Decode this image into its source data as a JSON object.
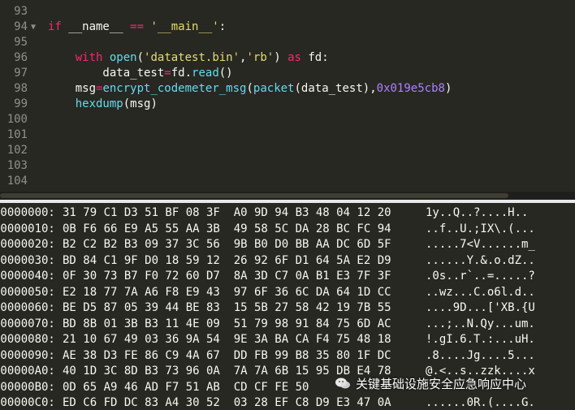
{
  "editor": {
    "lines": [
      {
        "num": "93",
        "fold": "",
        "tokens": []
      },
      {
        "num": "94",
        "fold": "▼",
        "tokens": [
          {
            "t": "if",
            "c": "kw"
          },
          {
            "t": " __name__ ",
            "c": ""
          },
          {
            "t": "==",
            "c": "kw"
          },
          {
            "t": " ",
            "c": ""
          },
          {
            "t": "'__main__'",
            "c": "str"
          },
          {
            "t": ":",
            "c": ""
          }
        ]
      },
      {
        "num": "95",
        "fold": "",
        "tokens": []
      },
      {
        "num": "96",
        "fold": "",
        "tokens": [
          {
            "t": "    ",
            "c": ""
          },
          {
            "t": "with",
            "c": "kw"
          },
          {
            "t": " ",
            "c": ""
          },
          {
            "t": "open",
            "c": "fn"
          },
          {
            "t": "(",
            "c": ""
          },
          {
            "t": "'datatest.bin'",
            "c": "str"
          },
          {
            "t": ",",
            "c": ""
          },
          {
            "t": "'rb'",
            "c": "str"
          },
          {
            "t": ") ",
            "c": ""
          },
          {
            "t": "as",
            "c": "kw"
          },
          {
            "t": " fd:",
            "c": ""
          }
        ]
      },
      {
        "num": "97",
        "fold": "",
        "tokens": [
          {
            "t": "        data_test",
            "c": ""
          },
          {
            "t": "=",
            "c": "kw"
          },
          {
            "t": "fd.",
            "c": ""
          },
          {
            "t": "read",
            "c": "fn"
          },
          {
            "t": "()",
            "c": ""
          }
        ]
      },
      {
        "num": "98",
        "fold": "",
        "tokens": [
          {
            "t": "    msg",
            "c": ""
          },
          {
            "t": "=",
            "c": "kw"
          },
          {
            "t": "encrypt_codemeter_msg",
            "c": "fn"
          },
          {
            "t": "(",
            "c": ""
          },
          {
            "t": "packet",
            "c": "fn"
          },
          {
            "t": "(data_test),",
            "c": ""
          },
          {
            "t": "0x019e5cb8",
            "c": "num"
          },
          {
            "t": ")",
            "c": ""
          }
        ]
      },
      {
        "num": "99",
        "fold": "",
        "tokens": [
          {
            "t": "    ",
            "c": ""
          },
          {
            "t": "hexdump",
            "c": "fn"
          },
          {
            "t": "(msg)",
            "c": ""
          }
        ]
      },
      {
        "num": "100",
        "fold": "",
        "tokens": []
      },
      {
        "num": "101",
        "fold": "",
        "tokens": []
      },
      {
        "num": "102",
        "fold": "",
        "tokens": []
      },
      {
        "num": "103",
        "fold": "",
        "tokens": []
      },
      {
        "num": "104",
        "fold": "",
        "tokens": []
      }
    ]
  },
  "console": {
    "rows": [
      {
        "addr": "00000000:",
        "bytes": "31 79 C1 D3 51 BF 08 3F  A0 9D 94 B3 48 04 12 20",
        "ascii": "1y..Q..?....H.."
      },
      {
        "addr": "00000010:",
        "bytes": "0B F6 66 E9 A5 55 AA 3B  49 58 5C DA 28 BC FC 94",
        "ascii": "..f..U.;IX\\.(..."
      },
      {
        "addr": "00000020:",
        "bytes": "B2 C2 B2 B3 09 37 3C 56  9B B0 D0 BB AA DC 6D 5F",
        "ascii": ".....7<V......m_"
      },
      {
        "addr": "00000030:",
        "bytes": "BD 84 C1 9F D0 18 59 12  26 92 6F D1 64 5A E2 D9",
        "ascii": "......Y.&.o.dZ.."
      },
      {
        "addr": "00000040:",
        "bytes": "0F 30 73 B7 F0 72 60 D7  8A 3D C7 0A B1 E3 7F 3F",
        "ascii": ".0s..r`..=.....?"
      },
      {
        "addr": "00000050:",
        "bytes": "E2 18 77 7A A6 F8 E9 43  97 6F 36 6C DA 64 1D CC",
        "ascii": "..wz...C.o6l.d.."
      },
      {
        "addr": "00000060:",
        "bytes": "BE D5 87 05 39 44 BE 83  15 5B 27 58 42 19 7B 55",
        "ascii": "....9D...['XB.{U"
      },
      {
        "addr": "00000070:",
        "bytes": "BD 8B 01 3B B3 11 4E 09  51 79 98 91 84 75 6D AC",
        "ascii": "...;..N.Qy...um."
      },
      {
        "addr": "00000080:",
        "bytes": "21 10 67 49 03 36 9A 54  9E 3A BA CA F4 75 48 18",
        "ascii": "!.gI.6.T.:...uH."
      },
      {
        "addr": "00000090:",
        "bytes": "AE 38 D3 FE 86 C9 4A 67  DD FB 99 B8 35 80 1F DC",
        "ascii": ".8....Jg....5..."
      },
      {
        "addr": "000000A0:",
        "bytes": "40 1D 3C 8D B3 73 96 0A  7A 7A 6B 15 95 DB E4 78",
        "ascii": "@.<..s..zzk....x"
      },
      {
        "addr": "000000B0:",
        "bytes": "0D 65 A9 46 AD F7 51 AB  CD CF FE 50",
        "ascii": ""
      },
      {
        "addr": "000000C0:",
        "bytes": "ED C6 FD DC 83 A4 30 52  03 28 EF C8 D9 E3 47 0A",
        "ascii": "......0R.(....G."
      }
    ]
  },
  "watermark": {
    "text": "关键基础设施安全应急响应中心",
    "icon": "wechat-icon"
  },
  "colors": {
    "background": "#272822",
    "keyword": "#f92672",
    "function": "#66d9ef",
    "string": "#e6db74",
    "number": "#ae81ff",
    "gutter": "#90908a"
  }
}
